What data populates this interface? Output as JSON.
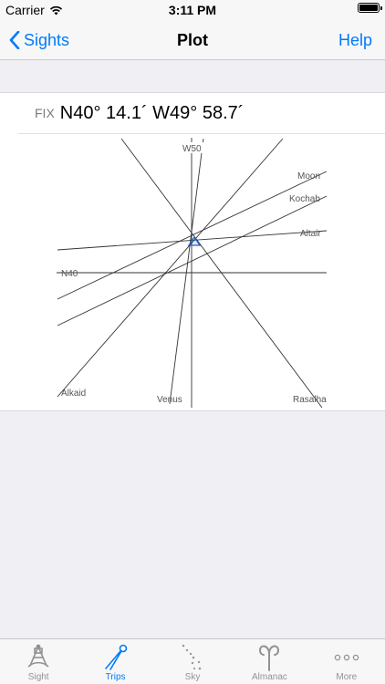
{
  "status_bar": {
    "carrier": "Carrier",
    "time": "3:11 PM",
    "battery_level": 1.0
  },
  "nav": {
    "back_label": "Sights",
    "title": "Plot",
    "right_label": "Help"
  },
  "fix": {
    "label": "FIX",
    "value": "N40° 14.1´ W49° 58.7´"
  },
  "plot_labels": {
    "meridian": "W50",
    "parallel": "N40",
    "moon": "Moon",
    "kochab": "Kochab",
    "altair": "Altair",
    "alkaid": "Alkaid",
    "venus": "Venus",
    "rasalhague": "Rasalha"
  },
  "colors": {
    "accent": "#007aff",
    "fix_marker": "#1a63c8",
    "line": "#333333"
  },
  "tabs": [
    {
      "label": "Sight",
      "icon": "sextant-icon",
      "active": false
    },
    {
      "label": "Trips",
      "icon": "compass-divider-icon",
      "active": true
    },
    {
      "label": "Sky",
      "icon": "constellation-icon",
      "active": false
    },
    {
      "label": "Almanac",
      "icon": "aries-icon",
      "active": false
    },
    {
      "label": "More",
      "icon": "more-dots-icon",
      "active": false
    }
  ]
}
